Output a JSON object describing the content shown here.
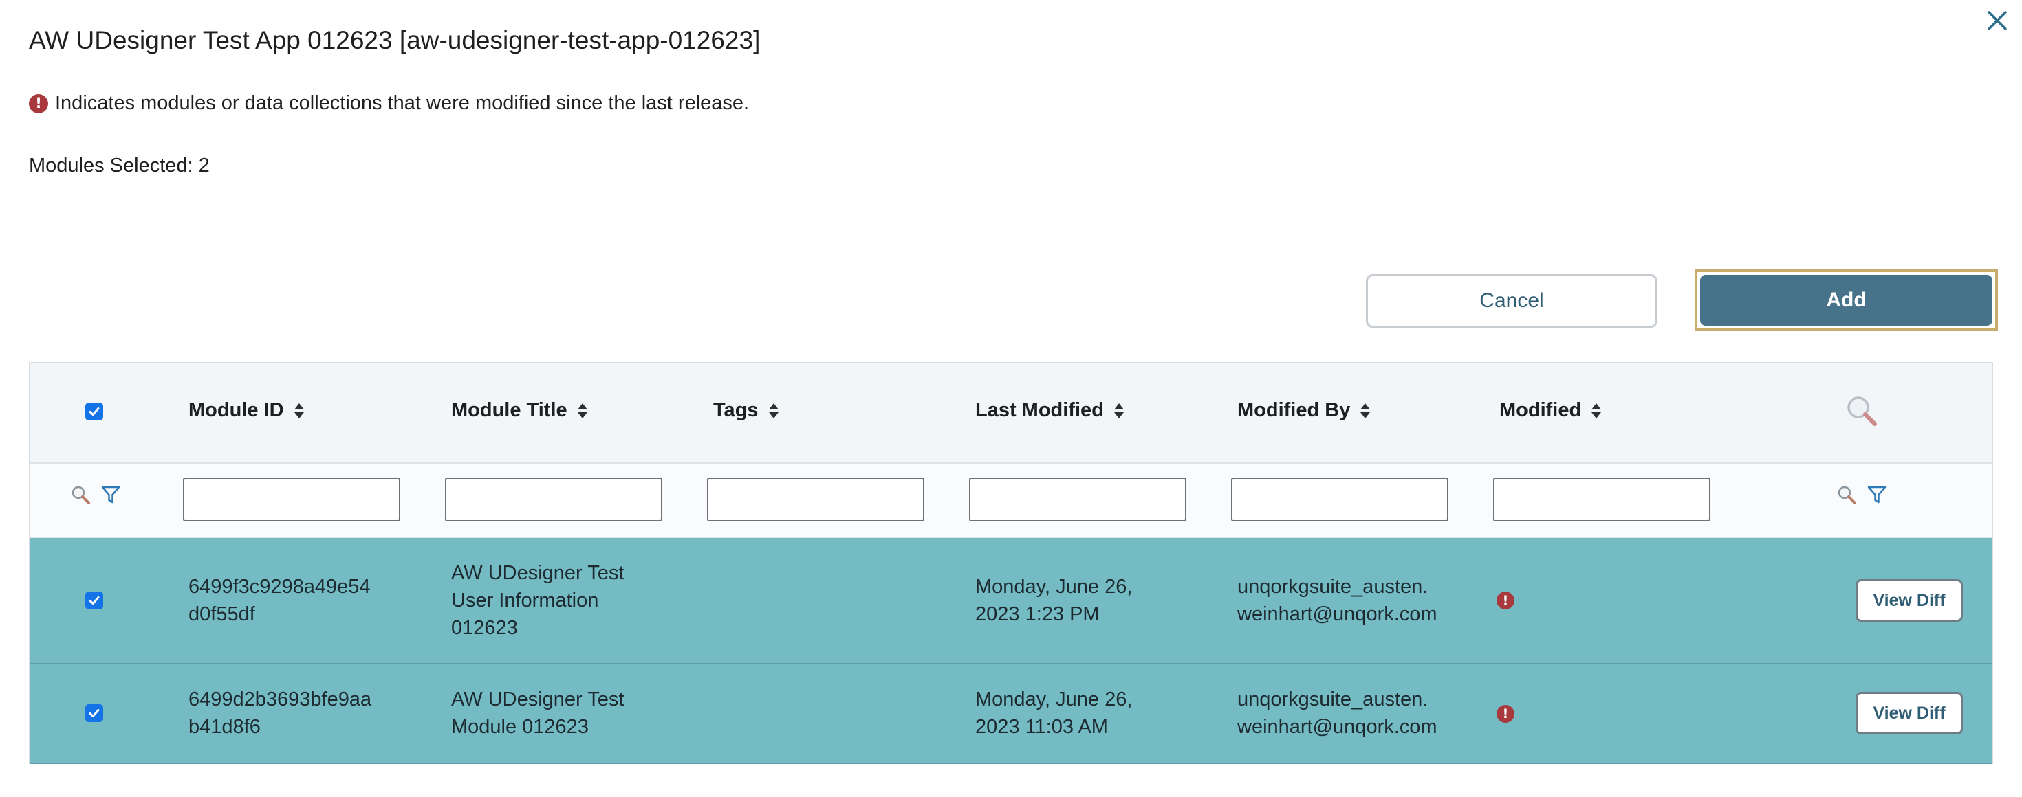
{
  "dialog": {
    "title": "AW UDesigner Test App 012623 [aw-udesigner-test-app-012623]",
    "notice": "Indicates modules or data collections that were modified since the last release.",
    "selected_count": "Modules Selected: 2",
    "alert_icon": "exclamation-circle-icon",
    "close_icon": "close-x-icon"
  },
  "actions": {
    "cancel_label": "Cancel",
    "add_label": "Add"
  },
  "table": {
    "columns": [
      {
        "label": "Module ID",
        "sortable": true
      },
      {
        "label": "Module Title",
        "sortable": true
      },
      {
        "label": "Tags",
        "sortable": true
      },
      {
        "label": "Last Modified",
        "sortable": true
      },
      {
        "label": "Modified By",
        "sortable": true
      },
      {
        "label": "Modified",
        "sortable": true
      }
    ],
    "header_select_all_checked": true,
    "filters": {
      "module_id": "",
      "module_title": "",
      "tags": "",
      "last_modified": "",
      "modified_by": "",
      "modified": ""
    },
    "rows": [
      {
        "checked": true,
        "module_id": [
          "6499f3c9298a49e54",
          "d0f55df"
        ],
        "module_title": [
          "AW UDesigner Test",
          "User Information",
          "012623"
        ],
        "tags": "",
        "last_modified": [
          "Monday, June 26,",
          "2023 1:23 PM"
        ],
        "modified_by": [
          "unqorkgsuite_austen.",
          "weinhart@unqork.com"
        ],
        "modified": true,
        "action_label": "View Diff"
      },
      {
        "checked": true,
        "module_id": [
          "6499d2b3693bfe9aa",
          "b41d8f6"
        ],
        "module_title": [
          "AW UDesigner Test",
          "Module 012623"
        ],
        "tags": "",
        "last_modified": [
          "Monday, June 26,",
          "2023 11:03 AM"
        ],
        "modified_by": [
          "unqorkgsuite_austen.",
          "weinhart@unqork.com"
        ],
        "modified": true,
        "action_label": "View Diff"
      }
    ]
  },
  "colors": {
    "row_selected_bg": "#74bbc4",
    "primary_button": "#46728a",
    "alert_red": "#a8393c",
    "checkbox_blue": "#1473e6",
    "focus_outline": "#c8ad6a"
  }
}
